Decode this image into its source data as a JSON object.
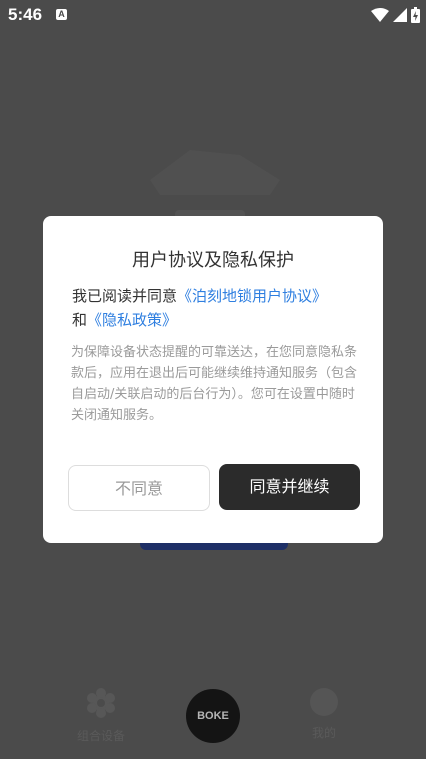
{
  "status_bar": {
    "time": "5:46",
    "notification_icon_letter": "A"
  },
  "dialog": {
    "title": "用户协议及隐私保护",
    "agreement_prefix": "我已阅读并同意",
    "user_agreement_link": "《泊刻地锁用户协议》",
    "and_text": "和",
    "privacy_policy_link": "《隐私政策》",
    "body_text": "为保障设备状态提醒的可靠送达，在您同意隐私条款后，应用在退出后可能继续维持通知服务（包含自启动/关联启动的后台行为）。您可在设置中随时关闭通知服务。",
    "disagree_label": "不同意",
    "agree_label": "同意并继续"
  },
  "background": {
    "nav_left_label": "组合设备",
    "nav_center_logo": "BOKE",
    "nav_right_label": "我的"
  },
  "colors": {
    "link": "#2f7fe0",
    "agree_button": "#2b2b2b",
    "overlay_background": "#4b4b4b"
  }
}
